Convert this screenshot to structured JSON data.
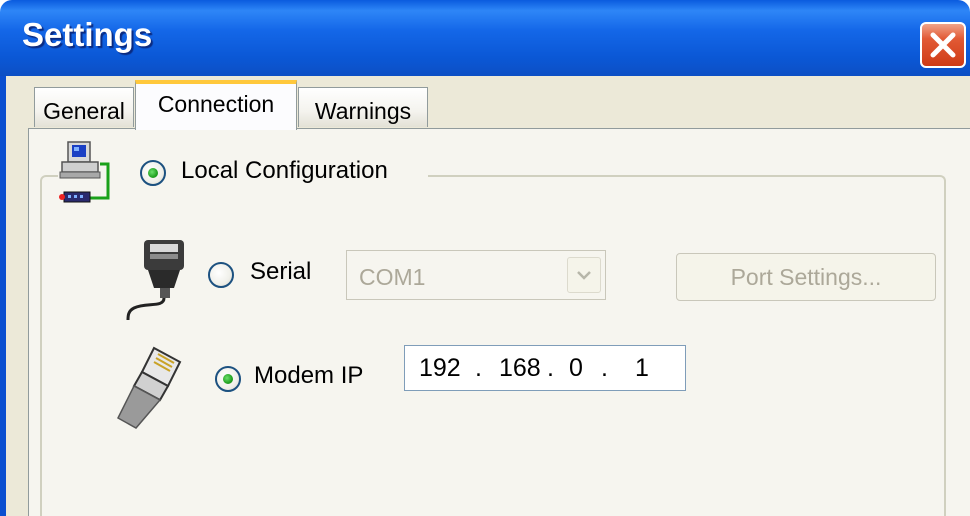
{
  "window": {
    "title": "Settings",
    "close_icon": "close-icon",
    "accent": "#0a5bde",
    "close_color": "#e25a35"
  },
  "tabs": [
    {
      "label": "General",
      "active": false
    },
    {
      "label": "Connection",
      "active": true
    },
    {
      "label": "Warnings",
      "active": false
    }
  ],
  "local_config": {
    "icon": "computer-network-icon",
    "label": "Local Configuration",
    "checked": true
  },
  "serial": {
    "icon": "serial-cable-icon",
    "label": "Serial",
    "checked": false,
    "port_value": "COM1",
    "port_settings_label": "Port Settings...",
    "disabled": true
  },
  "modem": {
    "icon": "ethernet-cable-icon",
    "label": "Modem IP",
    "checked": true,
    "ip": [
      "192",
      "168",
      "0",
      "1"
    ]
  }
}
